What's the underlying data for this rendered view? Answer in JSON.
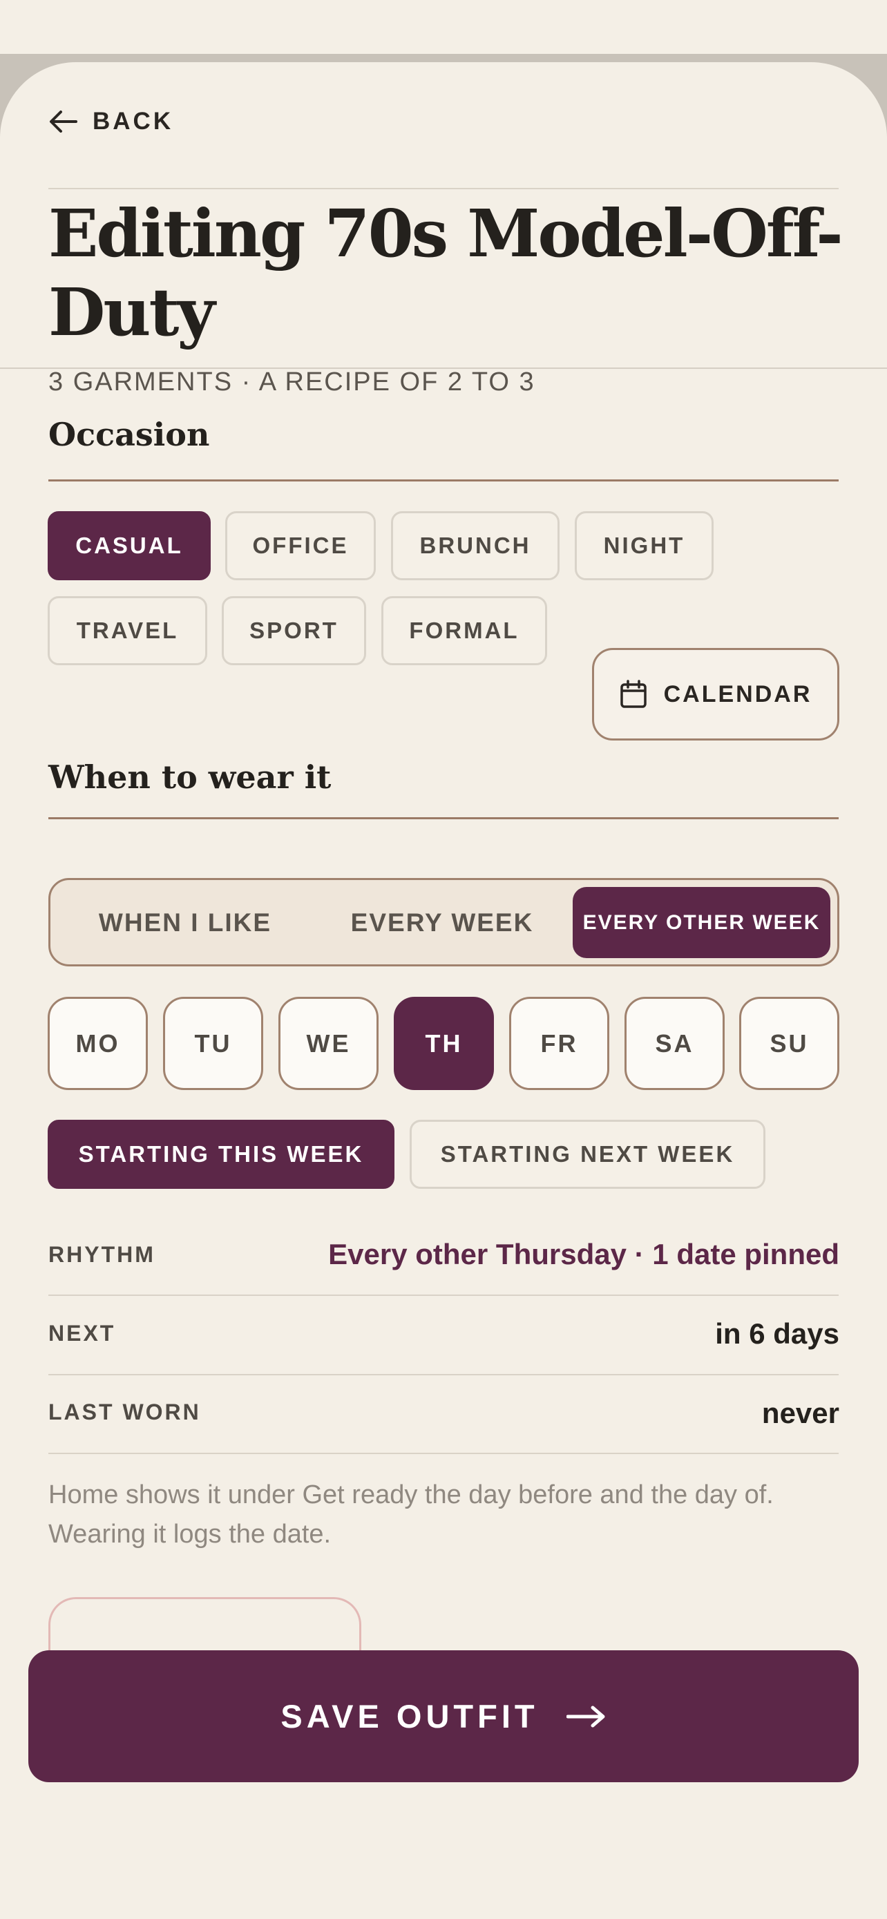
{
  "header": {
    "back_label": "BACK",
    "title": "Editing 70s Model-Off-Duty",
    "subtitle": "3 GARMENTS · A RECIPE OF 2 TO 3"
  },
  "occasion": {
    "heading": "Occasion",
    "chips": [
      {
        "label": "CASUAL",
        "selected": true
      },
      {
        "label": "OFFICE",
        "selected": false
      },
      {
        "label": "BRUNCH",
        "selected": false
      },
      {
        "label": "NIGHT",
        "selected": false
      },
      {
        "label": "TRAVEL",
        "selected": false
      },
      {
        "label": "SPORT",
        "selected": false
      },
      {
        "label": "FORMAL",
        "selected": false
      }
    ]
  },
  "schedule": {
    "heading": "When to wear it",
    "calendar_label": "CALENDAR",
    "calendar_icon": "calendar-icon",
    "frequency": {
      "options": [
        "WHEN I LIKE",
        "EVERY WEEK",
        "EVERY OTHER WEEK"
      ],
      "selected": "EVERY OTHER WEEK"
    },
    "days": {
      "options": [
        "MO",
        "TU",
        "WE",
        "TH",
        "FR",
        "SA",
        "SU"
      ],
      "selected": "TH"
    },
    "start": {
      "options": [
        "STARTING THIS WEEK",
        "STARTING NEXT WEEK"
      ],
      "selected": "STARTING THIS WEEK"
    }
  },
  "summary": {
    "rhythm_label": "RHYTHM",
    "rhythm_value": "Every other Thursday · 1 date pinned",
    "next_label": "NEXT",
    "next_value": "in 6 days",
    "last_worn_label": "LAST WORN",
    "last_worn_value": "never"
  },
  "note": "Home shows it under Get ready the day before and the day of. Wearing it logs the date.",
  "footer": {
    "save_label": "SAVE OUTFIT",
    "save_icon": "arrow-right-icon"
  },
  "colors": {
    "accent": "#5c2748",
    "background": "#f4efe6",
    "border": "#a0826e"
  }
}
